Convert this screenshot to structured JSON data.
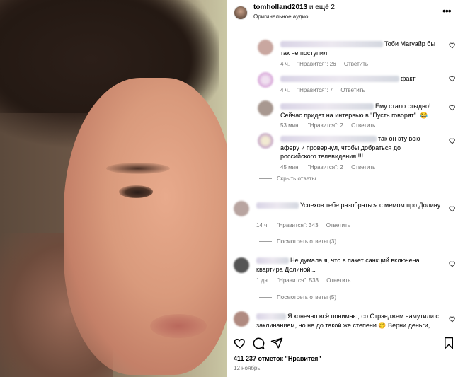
{
  "header": {
    "username": "tomholland2013",
    "others": "и ещё 2",
    "audio": "Оригинальное аудио",
    "more_icon": "more-horizontal-icon"
  },
  "comments": [
    {
      "text": "Тоби Магуайр бы так не поступил",
      "time": "4 ч.",
      "likes": "\"Нравится\": 26",
      "reply": "Ответить",
      "avatar_color": "#c9a7a0"
    },
    {
      "text": "факт",
      "time": "4 ч.",
      "likes": "\"Нравится\": 7",
      "reply": "Ответить",
      "avatar_color": "#d8a7d9"
    },
    {
      "text": "Ему стало стыдно! Сейчас придет на интервью в \"Пусть говорят\". 😂",
      "time": "53 мин.",
      "likes": "\"Нравится\": 2",
      "reply": "Ответить",
      "avatar_color": "#a89890"
    },
    {
      "text": "так он эту всю аферу и провернул, чтобы добраться до российского телевидения!!!!",
      "time": "45 мин.",
      "likes": "\"Нравится\": 2",
      "reply": "Ответить",
      "avatar_color": "#c7a8c9"
    },
    {
      "text": "Успехов тебе разобраться с мемом про Долину",
      "time": "14 ч.",
      "likes": "\"Нравится\": 343",
      "reply": "Ответить",
      "avatar_color": "#b8a4a0"
    },
    {
      "text": "Не думала я, что в пакет санкций включена квартира Долиной...",
      "time": "1 дн.",
      "likes": "\"Нравится\": 533",
      "reply": "Ответить",
      "avatar_color": "#555555"
    },
    {
      "text": "Я конечно всё понимаю, со Стрэнджем намутили с заклинанием, но не до такой же степени 🥴 Верни деньги,",
      "time": "",
      "likes": "",
      "reply": "",
      "avatar_color": "#b08a80"
    }
  ],
  "toggles": {
    "hide_replies": "Скрыть ответы",
    "view_replies_3": "Посмотреть ответы (3)",
    "view_replies_5": "Посмотреть ответы (5)"
  },
  "footer": {
    "likes": "411 237 отметок \"Нравится\"",
    "date": "12 ноябрь"
  },
  "icons": [
    "heart-icon",
    "comment-icon",
    "share-icon",
    "bookmark-icon"
  ],
  "colors": {
    "secondary_text": "#737373",
    "divider": "#efefef"
  }
}
